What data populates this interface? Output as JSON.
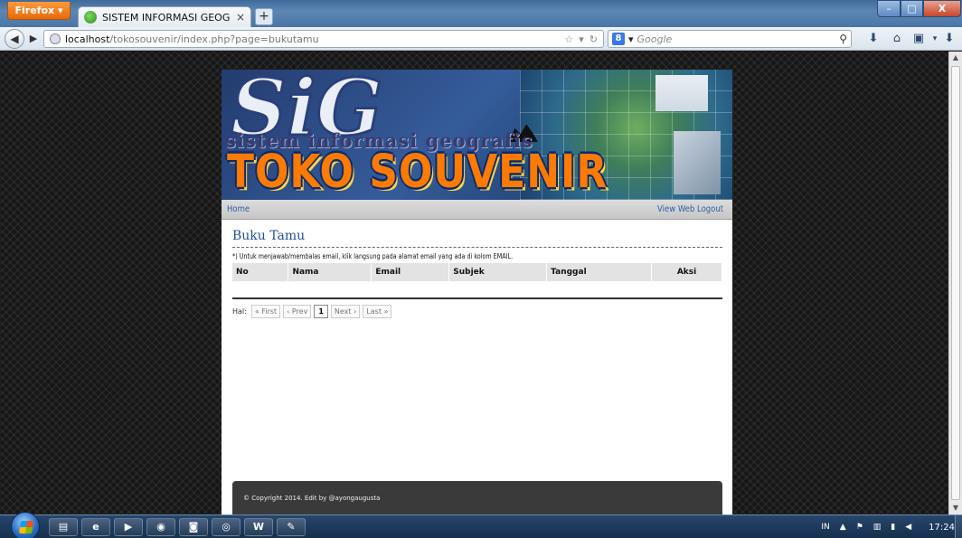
{
  "browser": {
    "firefox_label": "Firefox",
    "tab_title": "SISTEM INFORMASI GEOGRAFIS",
    "tab_close": "×",
    "new_tab": "+",
    "url_host": "localhost",
    "url_path": "/tokosouvenir/index.php?page=bukutamu",
    "search_placeholder": "Google",
    "search_engine_letter": "8",
    "win_min": "–",
    "win_max": "□",
    "win_close": "X"
  },
  "site": {
    "banner_subtitle": "sistem informasi geografis",
    "banner_title": "TOKO SOUVENIR",
    "banner_logo": "SiG",
    "menu": {
      "home": "Home",
      "view_web": "View Web",
      "logout": "Logout"
    },
    "page_title": "Buku Tamu",
    "note": "*) Untuk menjawab/membalas email, klik langsung pada alamat email yang ada di kolom EMAIL.",
    "table": {
      "headers": [
        "No",
        "Nama",
        "Email",
        "Subjek",
        "Tanggal",
        "Aksi"
      ],
      "rows": []
    },
    "pager": {
      "label": "Hal:",
      "first": "« First",
      "prev": "‹ Prev",
      "current": "1",
      "next": "Next ›",
      "last": "Last »"
    },
    "footer": "© Copyright 2014. Edit by @ayongaugusta"
  },
  "taskbar": {
    "language": "IN",
    "clock": "17:24",
    "apps": [
      "explorer",
      "ie",
      "media-player",
      "firefox",
      "app-orange",
      "chrome",
      "word",
      "paint"
    ]
  },
  "colors": {
    "menu_link": "#2b5fa5",
    "title_blue": "#1f4f95",
    "banner_orange": "#ff7a00"
  }
}
